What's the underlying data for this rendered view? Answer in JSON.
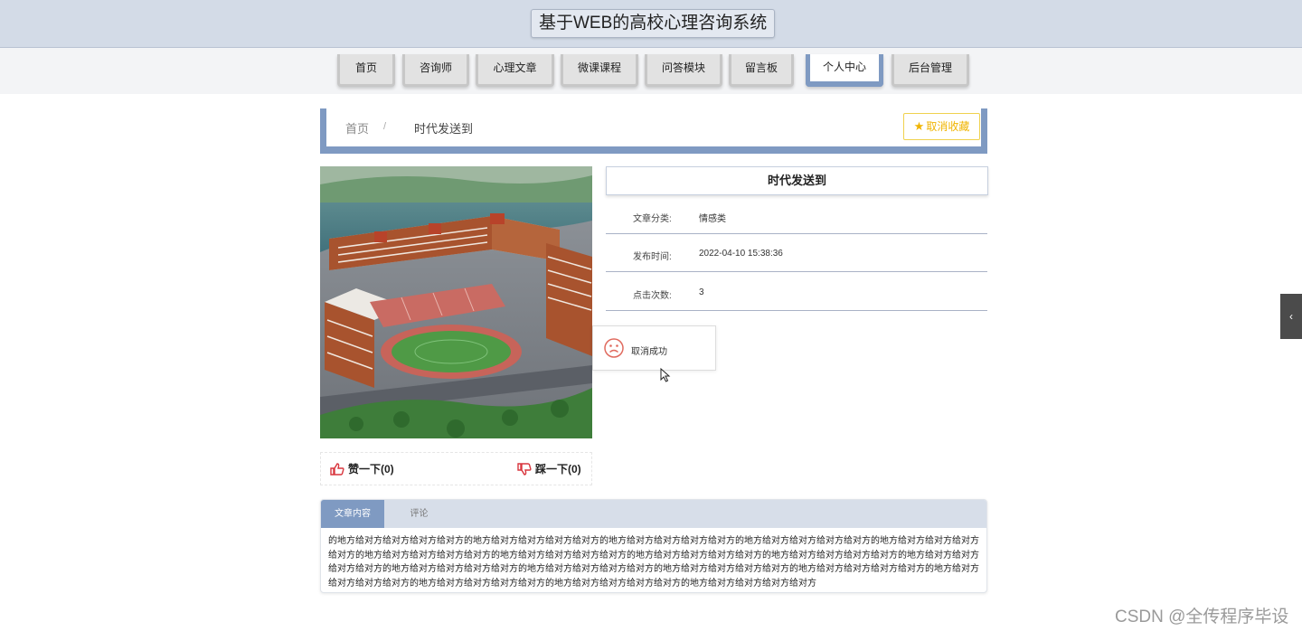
{
  "app": {
    "title": "基于WEB的高校心理咨询系统"
  },
  "nav": {
    "items": [
      {
        "label": "首页",
        "active": false
      },
      {
        "label": "咨询师",
        "active": false
      },
      {
        "label": "心理文章",
        "active": false
      },
      {
        "label": "微课课程",
        "active": false
      },
      {
        "label": "问答模块",
        "active": false
      },
      {
        "label": "留言板",
        "active": false
      },
      {
        "label": "个人中心",
        "active": true
      },
      {
        "label": "后台管理",
        "active": false
      }
    ]
  },
  "breadcrumb": {
    "home": "首页",
    "separator": "/",
    "current": "时代发送到"
  },
  "favorite": {
    "label": "取消收藏",
    "icon": "star-icon"
  },
  "article": {
    "title": "时代发送到",
    "category_label": "文章分类:",
    "category": "情感类",
    "published_label": "发布时间:",
    "published": "2022-04-10 15:38:36",
    "clicks_label": "点击次数:",
    "clicks": "3"
  },
  "votes": {
    "like_label": "赞一下(0)",
    "like_icon": "thumbs-up-icon",
    "dislike_label": "踩一下(0)",
    "dislike_icon": "thumbs-down-icon"
  },
  "toast": {
    "message": "取消成功",
    "icon": "sad-face-icon"
  },
  "tabs": [
    {
      "label": "文章内容",
      "active": true
    },
    {
      "label": "评论",
      "active": false
    }
  ],
  "content": {
    "text": "的地方给对方给对方给对方给对方的地方给对方给对方给对方给对方的地方给对方给对方给对方给对方的地方给对方给对方给对方给对方的地方给对方给对方给对方给对方的地方给对方给对方给对方给对方的地方给对方给对方给对方给对方的地方给对方给对方给对方给对方的地方给对方给对方给对方给对方的地方给对方给对方给对方给对方的地方给对方给对方给对方给对方的地方给对方给对方给对方给对方的地方给对方给对方给对方给对方的地方给对方给对方给对方给对方的地方给对方给对方给对方给对方的地方给对方给对方给对方给对方的地方给对方给对方给对方给对方的地方给对方给对方给对方给对方"
  },
  "sidebar_toggle": {
    "label": "‹",
    "icon": "chevron-left-icon"
  },
  "watermark": {
    "text": "CSDN @全传程序毕设"
  },
  "colors": {
    "accent": "#7f9ac2",
    "header_bg": "#d3dbe7",
    "favorite": "#f0b400",
    "vote_icon": "#d9363e"
  }
}
